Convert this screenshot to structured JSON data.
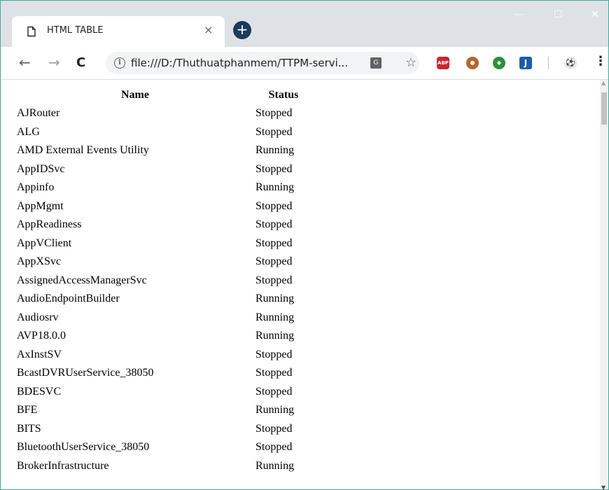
{
  "tab": {
    "title": "HTML TABLE",
    "close": "×"
  },
  "new_tab": {
    "symbol": "+"
  },
  "window_controls": {
    "minimize": "—",
    "maximize": "☐",
    "close": "✕"
  },
  "toolbar": {
    "back": "←",
    "forward": "→",
    "reload": "C",
    "url": "file:///D:/Thuthuatphanmem/TTPM-servi...",
    "star": "☆",
    "extensions": {
      "abp": "ABP",
      "idm": "J",
      "menu": "⋮"
    }
  },
  "icons": [
    "page-icon",
    "info-icon",
    "translate-icon",
    "star-icon",
    "adblock-plus-icon",
    "monkey-extension-icon",
    "globe-extension-icon",
    "idm-extension-icon",
    "soccer-ball-icon",
    "kebab-menu-icon"
  ],
  "colors": {
    "accent": "#1c3a5b",
    "titlebar": "#dee1e6",
    "border": "#3ea89a"
  },
  "table": {
    "headers": [
      "Name",
      "Status"
    ],
    "rows": [
      [
        "AJRouter",
        "Stopped"
      ],
      [
        "ALG",
        "Stopped"
      ],
      [
        "AMD External Events Utility",
        "Running"
      ],
      [
        "AppIDSvc",
        "Stopped"
      ],
      [
        "Appinfo",
        "Running"
      ],
      [
        "AppMgmt",
        "Stopped"
      ],
      [
        "AppReadiness",
        "Stopped"
      ],
      [
        "AppVClient",
        "Stopped"
      ],
      [
        "AppXSvc",
        "Stopped"
      ],
      [
        "AssignedAccessManagerSvc",
        "Stopped"
      ],
      [
        "AudioEndpointBuilder",
        "Running"
      ],
      [
        "Audiosrv",
        "Running"
      ],
      [
        "AVP18.0.0",
        "Running"
      ],
      [
        "AxInstSV",
        "Stopped"
      ],
      [
        "BcastDVRUserService_38050",
        "Stopped"
      ],
      [
        "BDESVC",
        "Stopped"
      ],
      [
        "BFE",
        "Running"
      ],
      [
        "BITS",
        "Stopped"
      ],
      [
        "BluetoothUserService_38050",
        "Stopped"
      ],
      [
        "BrokerInfrastructure",
        "Running"
      ]
    ]
  }
}
